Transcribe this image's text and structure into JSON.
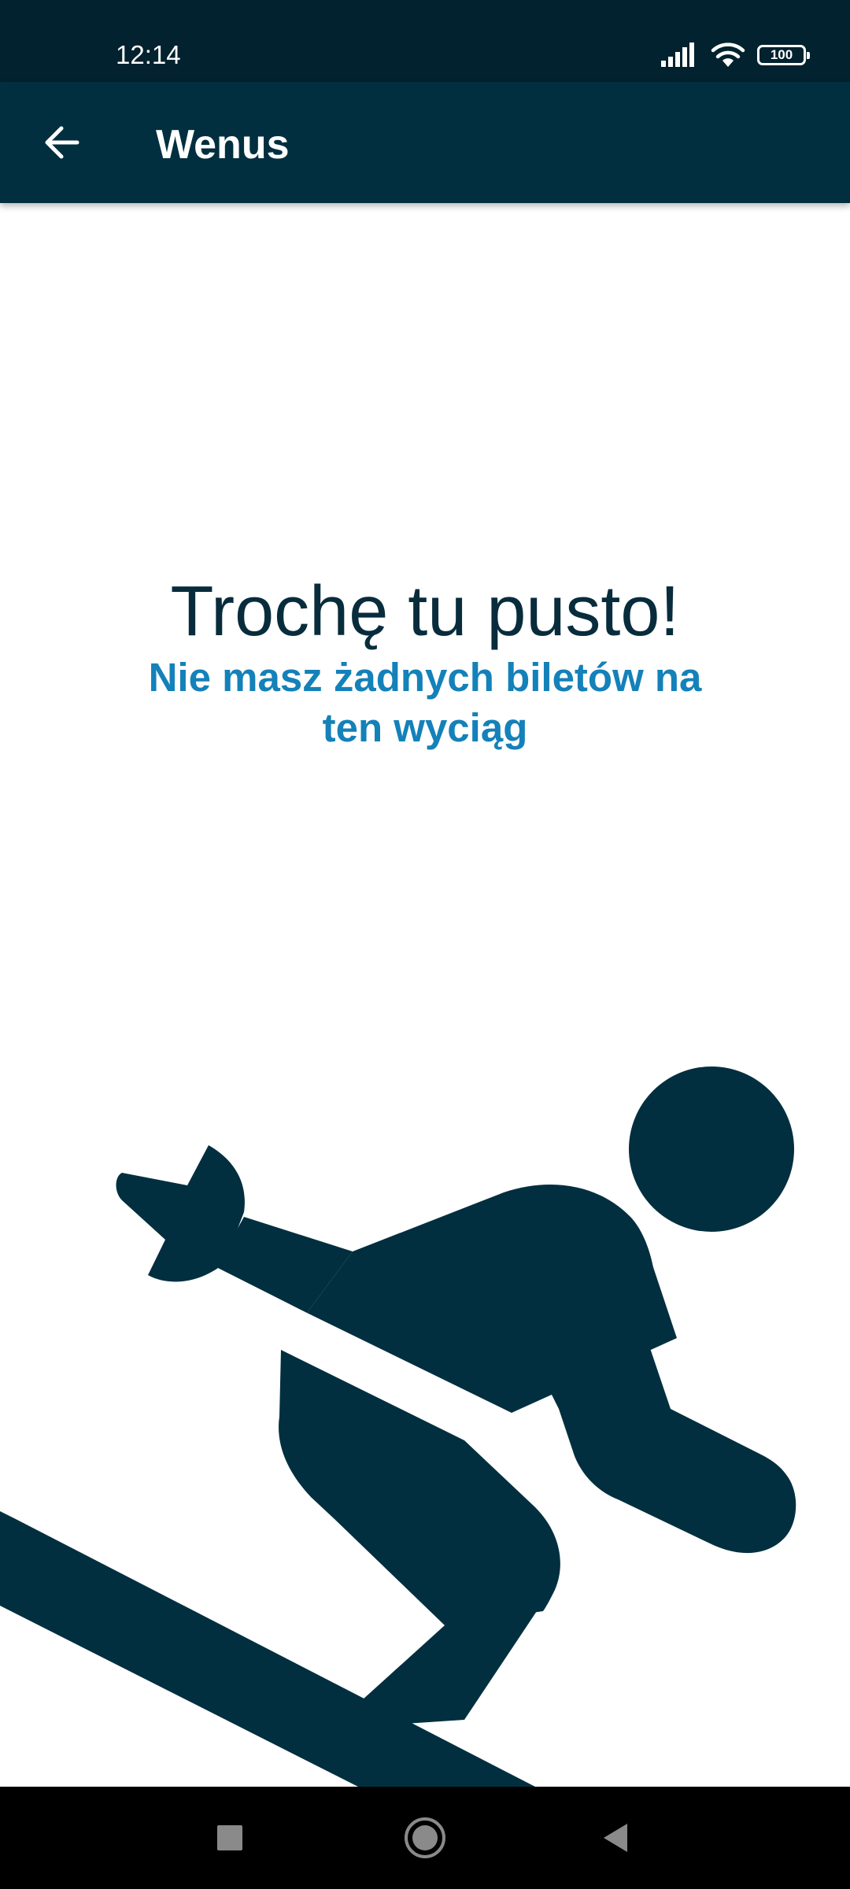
{
  "status_bar": {
    "time": "12:14",
    "battery_level": "100",
    "icons": [
      "signal-icon",
      "wifi-icon",
      "battery-icon"
    ]
  },
  "app_bar": {
    "title": "Wenus",
    "back_icon": "arrow-left-icon"
  },
  "empty_state": {
    "title": "Trochę tu pusto!",
    "subtitle": "Nie masz żadnych biletów na ten wyciąg",
    "illustration": "skier-icon"
  },
  "nav_bar": {
    "buttons": [
      "square-recents-icon",
      "circle-home-icon",
      "triangle-back-icon"
    ]
  },
  "colors": {
    "status_bar_bg": "#01222e",
    "app_bar_bg": "#022f3f",
    "title_text": "#082c3c",
    "subtitle_text": "#1481b9",
    "illustration": "#022f3f"
  }
}
